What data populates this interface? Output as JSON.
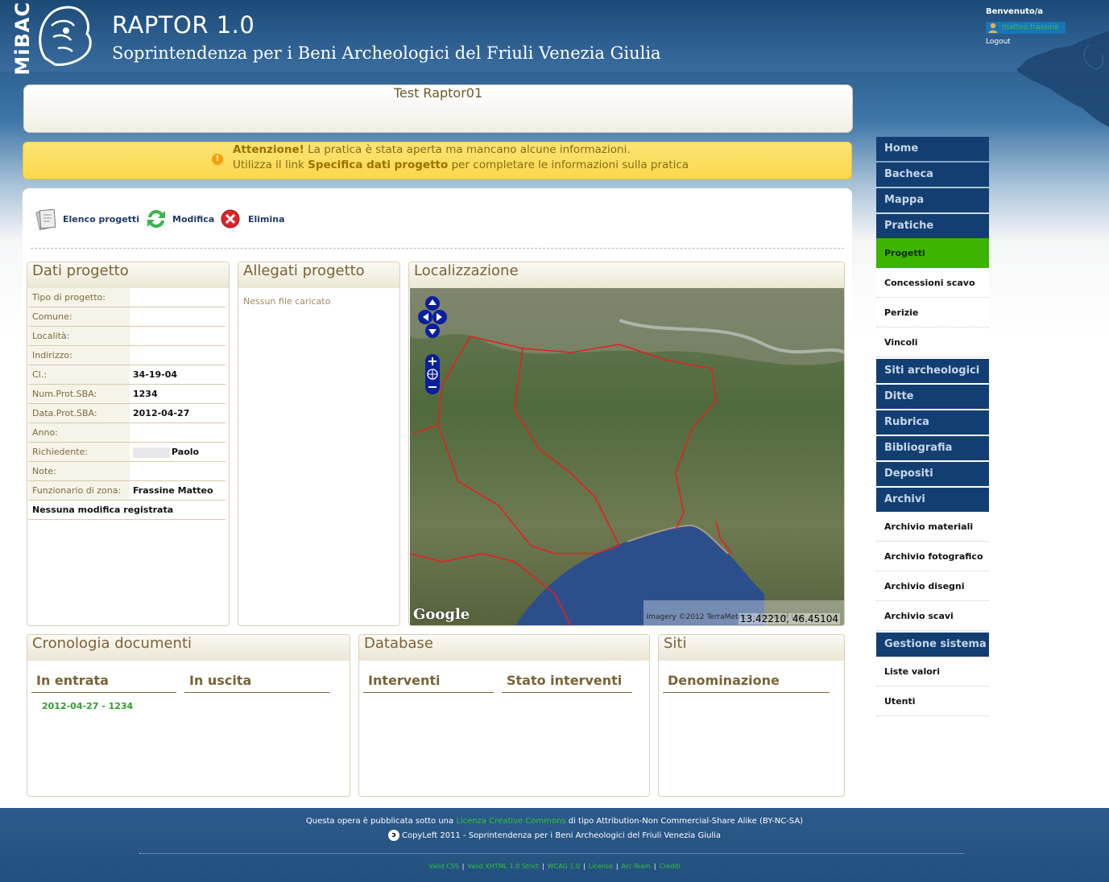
{
  "header": {
    "logo_text": "MiBAC",
    "app_title": "RAPTOR 1.0",
    "subtitle": "Soprintendenza per i Beni Archeologici del Friuli Venezia Giulia",
    "welcome": "Benvenuto/a",
    "username": "matteo.frassine",
    "logout": "Logout"
  },
  "project_title": "Test Raptor01",
  "warning": {
    "strong": "Attenzione!",
    "line1_rest": " La pratica è stata aperta ma mancano alcune informazioni.",
    "line2_pre": "Utilizza il link ",
    "line2_link": "Specifica dati progetto",
    "line2_post": " per completare le informazioni sulla pratica"
  },
  "toolbar": {
    "list_label": "Elenco progetti",
    "edit_label": "Modifica",
    "delete_label": "Elimina"
  },
  "dati_progetto": {
    "title": "Dati progetto",
    "rows": [
      {
        "key": "Tipo di progetto:",
        "value": ""
      },
      {
        "key": "Comune:",
        "value": ""
      },
      {
        "key": "Località:",
        "value": ""
      },
      {
        "key": "Indirizzo:",
        "value": ""
      },
      {
        "key": "Cl.:",
        "value": "34-19-04"
      },
      {
        "key": "Num.Prot.SBA:",
        "value": "1234"
      },
      {
        "key": "Data.Prot.SBA:",
        "value": "2012-04-27"
      },
      {
        "key": "Anno:",
        "value": ""
      },
      {
        "key": "Richiedente:",
        "value": "Paolo"
      },
      {
        "key": "Note:",
        "value": ""
      },
      {
        "key": "Funzionario di zona:",
        "value": "Frassine Matteo"
      }
    ],
    "footer_note": "Nessuna modifica registrata"
  },
  "allegati": {
    "title": "Allegati progetto",
    "empty": "Nessun file caricato"
  },
  "localizzazione": {
    "title": "Localizzazione",
    "coords": "13.42210, 46.45104",
    "attribution": "Imagery ©2012 TerraMetrics - Terms of Use",
    "google": "Google"
  },
  "cronologia": {
    "title": "Cronologia documenti",
    "col_in": "In entrata",
    "col_out": "In uscita",
    "entry": "2012-04-27 - 1234"
  },
  "database": {
    "title": "Database",
    "col1": "Interventi",
    "col2": "Stato interventi"
  },
  "siti": {
    "title": "Siti",
    "col1": "Denominazione"
  },
  "nav": {
    "home": "Home",
    "bacheca": "Bacheca",
    "mappa": "Mappa",
    "pratiche": "Pratiche",
    "progetti": "Progetti",
    "concessioni": "Concessioni scavo",
    "perizie": "Perizie",
    "vincoli": "Vincoli",
    "siti": "Siti archeologici",
    "ditte": "Ditte",
    "rubrica": "Rubrica",
    "bibliografia": "Bibliografia",
    "depositi": "Depositi",
    "archivi": "Archivi",
    "arch_materiali": "Archivio materiali",
    "arch_foto": "Archivio fotografico",
    "arch_disegni": "Archivio disegni",
    "arch_scavi": "Archivio scavi",
    "gestione": "Gestione sistema",
    "liste": "Liste valori",
    "utenti": "Utenti"
  },
  "footer": {
    "license_pre": "Questa opera è pubblicata sotto una ",
    "license_link": "Licenza Creative Commons",
    "license_post": " di tipo Attribution-Non Commercial-Share Alike (BY-NC-SA)",
    "copyleft": "CopyLeft 2011 - Soprintendenza per i Beni Archeologici del Friuli Venezia Giulia",
    "links": [
      "Valid CSS",
      "Valid XHTML 1.0 Strict",
      "WCAG 1.0",
      "License",
      "Arc-Team",
      "Crediti"
    ]
  },
  "colors": {
    "nav_main": "#123e72",
    "nav_active": "#3cb500",
    "heading_brown": "#7a6335",
    "warning_bg": "#fcd84b"
  }
}
